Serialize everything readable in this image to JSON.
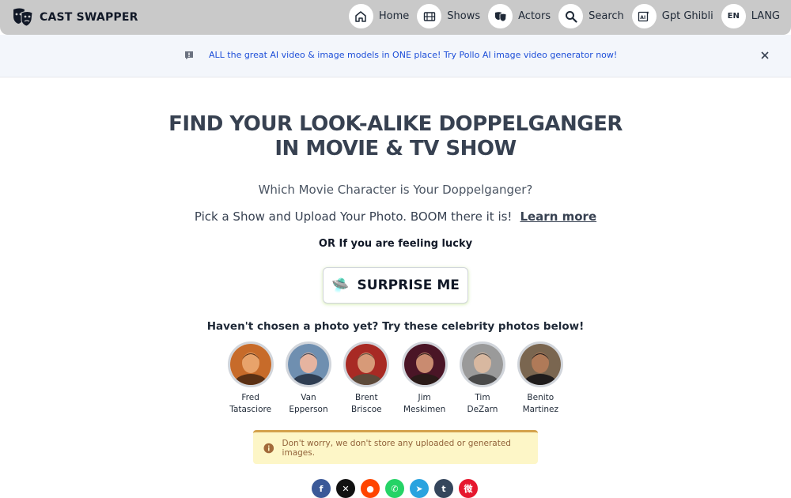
{
  "brand": {
    "name": "CAST SWAPPER"
  },
  "nav": {
    "items": [
      {
        "label": "Home",
        "icon": "home-icon"
      },
      {
        "label": "Shows",
        "icon": "film-icon"
      },
      {
        "label": "Actors",
        "icon": "theater-masks-icon"
      },
      {
        "label": "Search",
        "icon": "search-icon"
      },
      {
        "label": "Gpt Ghibli",
        "icon": "ai-image-icon"
      },
      {
        "label": "LANG",
        "icon": "language-icon",
        "badge": "EN"
      }
    ]
  },
  "banner": {
    "text": "ALL the great AI video & image models in ONE place! Try Pollo AI image video generator now!",
    "accent": "#1d4ed8"
  },
  "hero": {
    "title_line1": "FIND YOUR LOOK-ALIKE DOPPELGANGER",
    "title_line2": "IN MOVIE & TV SHOW",
    "subtitle": "Which Movie Character is Your Doppelganger?",
    "instruction": "Pick a Show and Upload Your Photo. BOOM there it is!",
    "learn_more": "Learn more",
    "lucky": "OR If you are feeling lucky",
    "surprise_label": "SURPRISE ME",
    "surprise_emoji": "🛸"
  },
  "celebrities": {
    "heading": "Haven't chosen a photo yet? Try these celebrity photos below!",
    "items": [
      {
        "first": "Fred",
        "last": "Tatasciore",
        "colors": [
          "#c76b2a",
          "#5a3014",
          "#e8a36b"
        ]
      },
      {
        "first": "Van",
        "last": "Epperson",
        "colors": [
          "#6f8fb0",
          "#2f3e52",
          "#e6b4a0"
        ]
      },
      {
        "first": "Brent",
        "last": "Briscoe",
        "colors": [
          "#a82a24",
          "#5c4a3a",
          "#d79a78"
        ]
      },
      {
        "first": "Jim",
        "last": "Meskimen",
        "colors": [
          "#4a1526",
          "#2a1a18",
          "#c98b70"
        ]
      },
      {
        "first": "Tim",
        "last": "DeZarn",
        "colors": [
          "#9a9a9a",
          "#4a4a4a",
          "#d8b8a0"
        ]
      },
      {
        "first": "Benito",
        "last": "Martinez",
        "colors": [
          "#7a6650",
          "#1f1c1c",
          "#b07a58"
        ]
      }
    ]
  },
  "notice": {
    "text": "Don't worry, we don't store any uploaded or generated images."
  },
  "share": {
    "items": [
      {
        "name": "facebook",
        "color": "#3b5998",
        "glyph": "f"
      },
      {
        "name": "x",
        "color": "#111111",
        "glyph": "✕"
      },
      {
        "name": "reddit",
        "color": "#ff4500",
        "glyph": "●"
      },
      {
        "name": "whatsapp",
        "color": "#25d366",
        "glyph": "✆"
      },
      {
        "name": "telegram",
        "color": "#2aa3df",
        "glyph": "➤"
      },
      {
        "name": "tumblr",
        "color": "#35465c",
        "glyph": "t"
      },
      {
        "name": "weibo",
        "color": "#e6162d",
        "glyph": "微"
      }
    ]
  }
}
